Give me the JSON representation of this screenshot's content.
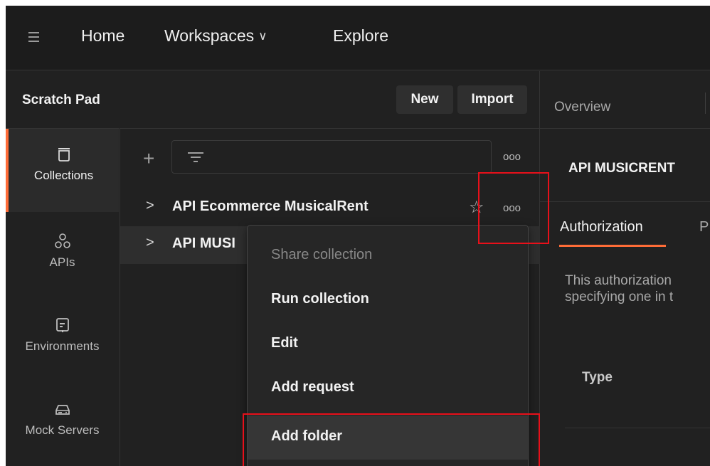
{
  "topbar": {
    "nav": [
      {
        "label": "Home"
      },
      {
        "label": "Workspaces"
      },
      {
        "label": "Explore"
      }
    ]
  },
  "scratch_pad": {
    "title": "Scratch Pad",
    "new_label": "New",
    "import_label": "Import"
  },
  "sidebar": {
    "items": [
      {
        "label": "Collections",
        "icon": "collections-icon",
        "active": true
      },
      {
        "label": "APIs",
        "icon": "apis-icon"
      },
      {
        "label": "Environments",
        "icon": "environments-icon"
      },
      {
        "label": "Mock Servers",
        "icon": "mock-servers-icon"
      }
    ]
  },
  "collections": {
    "more_label": "ooo",
    "items": [
      {
        "name": "API Ecommerce MusicalRent",
        "caret": ">"
      },
      {
        "name": "API MUSI",
        "caret": ">"
      }
    ]
  },
  "context_menu": {
    "items": [
      {
        "label": "Share collection",
        "disabled": true
      },
      {
        "label": "Run collection"
      },
      {
        "label": "Edit"
      },
      {
        "label": "Add request"
      },
      {
        "label": "Add folder",
        "hovered": true
      }
    ]
  },
  "right_pane": {
    "overview_label": "Overview",
    "collection_name": "API MUSICRENT",
    "tabs": [
      {
        "label": "Authorization",
        "active": true
      },
      {
        "label": "P"
      }
    ],
    "description_line1": "This authorization",
    "description_line2": "specifying one in t",
    "type_label": "Type"
  },
  "colors": {
    "accent": "#ff6c37",
    "highlight": "#e8101a",
    "background": "#212121"
  }
}
